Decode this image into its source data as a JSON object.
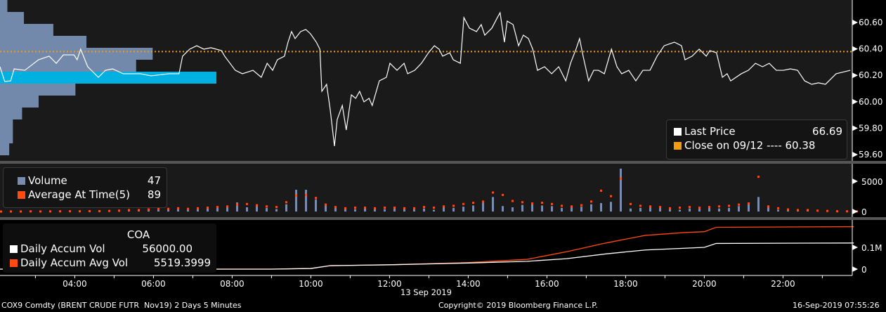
{
  "chart_data": [
    {
      "type": "line",
      "title": "Price",
      "ylim": [
        59.55,
        60.72
      ],
      "yticks": [
        "60.60",
        "60.40",
        "60.20",
        "60.00",
        "59.80",
        "59.60"
      ],
      "ytick_values": [
        60.6,
        60.4,
        60.2,
        60.0,
        59.8,
        59.6
      ],
      "series": [
        {
          "name": "Last Price",
          "color": "#ffffff",
          "points": [
            [
              2.1,
              60.265
            ],
            [
              2.22,
              60.153
            ],
            [
              2.37,
              60.158
            ],
            [
              2.46,
              60.249
            ],
            [
              2.73,
              60.238
            ],
            [
              3.08,
              60.318
            ],
            [
              3.35,
              60.345
            ],
            [
              3.53,
              60.291
            ],
            [
              3.71,
              60.355
            ],
            [
              3.98,
              60.355
            ],
            [
              4.06,
              60.318
            ],
            [
              4.15,
              60.398
            ],
            [
              4.33,
              60.265
            ],
            [
              4.6,
              60.185
            ],
            [
              4.78,
              60.238
            ],
            [
              4.96,
              60.249
            ],
            [
              5.23,
              60.212
            ],
            [
              5.67,
              60.212
            ],
            [
              5.94,
              60.196
            ],
            [
              6.39,
              60.212
            ],
            [
              6.65,
              60.212
            ],
            [
              6.74,
              60.345
            ],
            [
              6.92,
              60.398
            ],
            [
              7.1,
              60.424
            ],
            [
              7.28,
              60.398
            ],
            [
              7.46,
              60.409
            ],
            [
              7.73,
              60.387
            ],
            [
              7.81,
              60.345
            ],
            [
              8.08,
              60.238
            ],
            [
              8.26,
              60.212
            ],
            [
              8.53,
              60.238
            ],
            [
              8.74,
              60.185
            ],
            [
              8.89,
              60.291
            ],
            [
              9.03,
              60.238
            ],
            [
              9.15,
              60.318
            ],
            [
              9.33,
              60.345
            ],
            [
              9.42,
              60.451
            ],
            [
              9.51,
              60.531
            ],
            [
              9.6,
              60.478
            ],
            [
              9.74,
              60.531
            ],
            [
              9.87,
              60.547
            ],
            [
              9.99,
              60.515
            ],
            [
              10.14,
              60.451
            ],
            [
              10.23,
              60.398
            ],
            [
              10.28,
              60.079
            ],
            [
              10.4,
              60.132
            ],
            [
              10.49,
              59.946
            ],
            [
              10.6,
              59.664
            ],
            [
              10.67,
              59.866
            ],
            [
              10.8,
              59.972
            ],
            [
              10.9,
              59.786
            ],
            [
              11.03,
              60.052
            ],
            [
              11.14,
              60.026
            ],
            [
              11.24,
              60.079
            ],
            [
              11.35,
              59.999
            ],
            [
              11.48,
              60.026
            ],
            [
              11.56,
              59.972
            ],
            [
              11.74,
              60.158
            ],
            [
              11.92,
              60.185
            ],
            [
              12.01,
              60.291
            ],
            [
              12.19,
              60.238
            ],
            [
              12.37,
              60.291
            ],
            [
              12.46,
              60.212
            ],
            [
              12.64,
              60.238
            ],
            [
              12.81,
              60.291
            ],
            [
              12.99,
              60.371
            ],
            [
              13.14,
              60.424
            ],
            [
              13.26,
              60.398
            ],
            [
              13.35,
              60.345
            ],
            [
              13.53,
              60.371
            ],
            [
              13.62,
              60.318
            ],
            [
              13.8,
              60.291
            ],
            [
              13.89,
              60.637
            ],
            [
              14.03,
              60.557
            ],
            [
              14.21,
              60.531
            ],
            [
              14.33,
              60.584
            ],
            [
              14.42,
              60.504
            ],
            [
              14.6,
              60.557
            ],
            [
              14.74,
              60.637
            ],
            [
              14.81,
              60.674
            ],
            [
              14.92,
              60.451
            ],
            [
              14.99,
              60.611
            ],
            [
              15.14,
              60.584
            ],
            [
              15.28,
              60.424
            ],
            [
              15.4,
              60.504
            ],
            [
              15.53,
              60.478
            ],
            [
              15.64,
              60.398
            ],
            [
              15.76,
              60.238
            ],
            [
              15.94,
              60.265
            ],
            [
              16.12,
              60.212
            ],
            [
              16.3,
              60.265
            ],
            [
              16.48,
              60.158
            ],
            [
              16.6,
              60.291
            ],
            [
              16.74,
              60.398
            ],
            [
              16.83,
              60.478
            ],
            [
              16.92,
              60.345
            ],
            [
              17.06,
              60.158
            ],
            [
              17.19,
              60.238
            ],
            [
              17.31,
              60.238
            ],
            [
              17.46,
              60.212
            ],
            [
              17.64,
              60.398
            ],
            [
              17.78,
              60.265
            ],
            [
              17.9,
              60.212
            ],
            [
              18.08,
              60.238
            ],
            [
              18.26,
              60.158
            ],
            [
              18.44,
              60.238
            ],
            [
              18.62,
              60.238
            ],
            [
              18.8,
              60.345
            ],
            [
              18.98,
              60.424
            ],
            [
              19.24,
              60.451
            ],
            [
              19.42,
              60.424
            ],
            [
              19.51,
              60.318
            ],
            [
              19.69,
              60.345
            ],
            [
              19.87,
              60.398
            ],
            [
              20.05,
              60.345
            ],
            [
              20.14,
              60.387
            ],
            [
              20.31,
              60.371
            ],
            [
              20.46,
              60.185
            ],
            [
              20.58,
              60.212
            ],
            [
              20.67,
              60.158
            ],
            [
              20.94,
              60.212
            ],
            [
              21.12,
              60.238
            ],
            [
              21.3,
              60.291
            ],
            [
              21.48,
              60.265
            ],
            [
              21.65,
              60.291
            ],
            [
              21.83,
              60.238
            ],
            [
              22.01,
              60.238
            ],
            [
              22.19,
              60.249
            ],
            [
              22.37,
              60.238
            ],
            [
              22.55,
              60.158
            ],
            [
              22.73,
              60.132
            ],
            [
              22.9,
              60.143
            ],
            [
              23.08,
              60.132
            ],
            [
              23.35,
              60.212
            ],
            [
              23.71,
              60.238
            ]
          ]
        },
        {
          "name": "Close on 09/12",
          "color": "#f39c12",
          "value": 60.38
        }
      ],
      "volume_profile": {
        "price_bins": [
          60.69,
          60.6,
          60.51,
          60.42,
          60.32,
          60.24,
          60.15,
          60.06,
          59.97,
          59.88,
          59.79,
          59.69,
          59.6
        ],
        "volumes": [
          4,
          13,
          29,
          47,
          83,
          74,
          100,
          41,
          21,
          12,
          7,
          7,
          5
        ],
        "highlight_bin": 60.15
      },
      "legend": {
        "last_price_label": "Last Price",
        "last_price_value": "66.69",
        "close_label": "Close on 09/12 ---- 60.38"
      }
    },
    {
      "type": "bar",
      "title": "Volume",
      "ylim": [
        0,
        8000
      ],
      "yticks": [
        "5000",
        "0"
      ],
      "ytick_values": [
        5000,
        0
      ],
      "start_hour": 2.1,
      "step_hours": 0.25,
      "volume": [
        50,
        40,
        30,
        60,
        40,
        50,
        80,
        60,
        40,
        60,
        80,
        100,
        150,
        120,
        200,
        250,
        300,
        350,
        400,
        300,
        400,
        500,
        600,
        800,
        1500,
        700,
        1000,
        600,
        400,
        1200,
        3600,
        3600,
        2000,
        1000,
        600,
        500,
        400,
        500,
        500,
        400,
        600,
        500,
        400,
        500,
        300,
        700,
        600,
        800,
        1000,
        1500,
        2400,
        900,
        700,
        1100,
        1300,
        1000,
        900,
        600,
        700,
        800,
        1200,
        1400,
        1600,
        7100,
        500,
        600,
        800,
        700,
        400,
        300,
        500,
        700,
        600,
        500,
        600,
        900,
        1200,
        2400,
        800,
        300,
        200,
        150,
        200,
        150,
        120,
        100,
        90,
        80
      ],
      "avg": [
        50,
        60,
        60,
        80,
        70,
        80,
        90,
        100,
        100,
        120,
        120,
        150,
        200,
        300,
        300,
        400,
        500,
        500,
        600,
        500,
        600,
        700,
        800,
        900,
        1200,
        1300,
        1100,
        900,
        800,
        1600,
        2700,
        2800,
        2300,
        1200,
        800,
        600,
        700,
        700,
        600,
        700,
        700,
        600,
        600,
        800,
        700,
        900,
        1000,
        1300,
        1500,
        1700,
        3200,
        2800,
        1800,
        1600,
        1400,
        1500,
        1300,
        1000,
        900,
        1100,
        1700,
        3500,
        2600,
        5500,
        1300,
        1000,
        900,
        800,
        600,
        700,
        800,
        700,
        800,
        900,
        1000,
        1200,
        1400,
        5800,
        900,
        600,
        400,
        300,
        300,
        200,
        150,
        100,
        90,
        80
      ],
      "legend": {
        "volume_label": "Volume",
        "volume_value": "47",
        "avg_label": "Average At Time(5)",
        "avg_value": "89"
      }
    },
    {
      "type": "line",
      "title": "COA",
      "ylim": [
        0,
        230000
      ],
      "yticks": [
        "0.1M",
        "0"
      ],
      "ytick_values": [
        100000,
        0
      ],
      "series": [
        {
          "name": "Daily Accum Vol",
          "color": "#ffffff",
          "points": [
            [
              2.1,
              0
            ],
            [
              9.0,
              0
            ],
            [
              10.0,
              3000
            ],
            [
              10.5,
              16000
            ],
            [
              12,
              20000
            ],
            [
              14,
              28000
            ],
            [
              15.5,
              36000
            ],
            [
              16.5,
              48000
            ],
            [
              17.5,
              70000
            ],
            [
              18.5,
              88000
            ],
            [
              19.5,
              96000
            ],
            [
              20,
              100000
            ],
            [
              20.3,
              118000
            ],
            [
              23.8,
              120000
            ]
          ]
        },
        {
          "name": "Daily Accum Avg Vol",
          "color": "#ff4a12",
          "points": [
            [
              2.1,
              0
            ],
            [
              9.0,
              0
            ],
            [
              10.0,
              3000
            ],
            [
              10.5,
              16000
            ],
            [
              12,
              20000
            ],
            [
              14,
              30000
            ],
            [
              15.5,
              45000
            ],
            [
              16.5,
              80000
            ],
            [
              17.5,
              120000
            ],
            [
              18.5,
              155000
            ],
            [
              19.5,
              168000
            ],
            [
              20,
              172000
            ],
            [
              20.3,
              192000
            ],
            [
              23.8,
              195000
            ]
          ]
        }
      ],
      "legend": {
        "title": "COA",
        "accum_label": "Daily Accum Vol",
        "accum_value": "56000.00",
        "avg_label": "Daily Accum Avg Vol",
        "avg_value": "5519.3999"
      }
    }
  ],
  "xaxis": {
    "ticks": [
      "04:00",
      "06:00",
      "08:00",
      "10:00",
      "12:00",
      "14:00",
      "16:00",
      "18:00",
      "20:00",
      "22:00"
    ],
    "tick_hours": [
      4,
      6,
      8,
      10,
      12,
      14,
      16,
      18,
      20,
      22
    ],
    "date_label": "13 Sep 2019"
  },
  "status": {
    "left": "COX9 Comdty (BRENT CRUDE FUTR  Nov19) 2 Days 5 Minutes",
    "center": "Copyright© 2019 Bloomberg Finance L.P.",
    "right": "16-Sep-2019 07:55:26"
  }
}
